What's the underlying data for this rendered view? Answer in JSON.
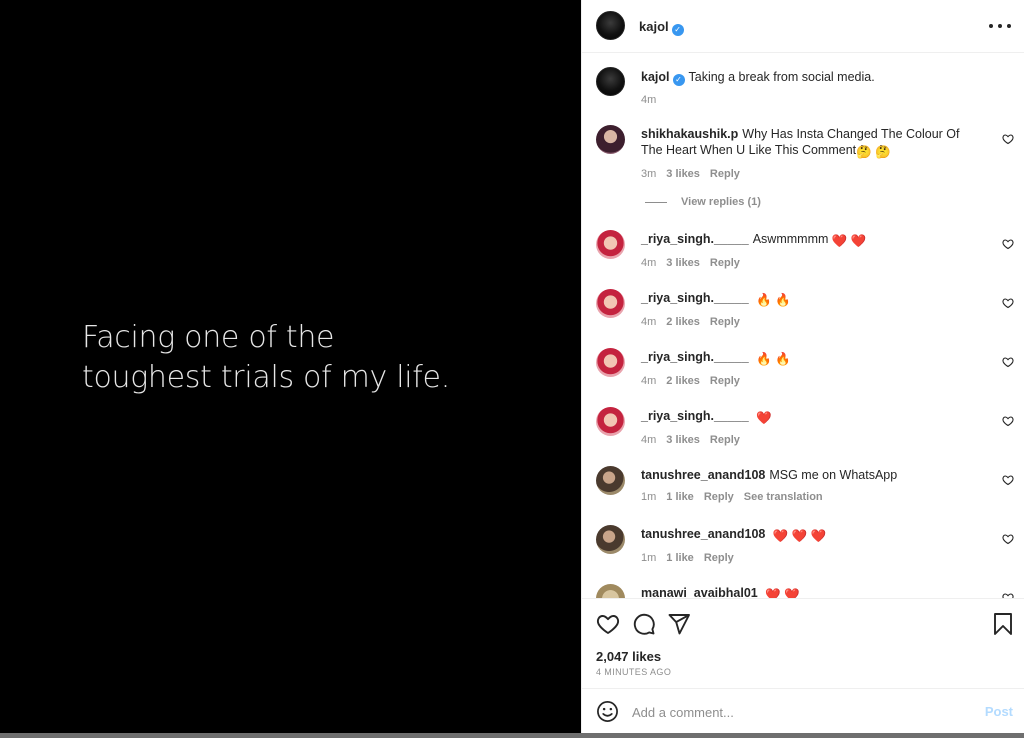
{
  "media": {
    "line1": "Facing one of the",
    "line2": "toughest trials of my life."
  },
  "header": {
    "username": "kajol",
    "verified_glyph": "✓",
    "more_icon": "more-dots-icon"
  },
  "caption": {
    "username": "kajol",
    "text": "Taking a break from social media.",
    "time": "4m"
  },
  "comments": [
    {
      "username": "shikhakaushik.p",
      "text": "Why Has Insta Changed The Colour Of The Heart When U Like This Comment",
      "emoji": "🤔 🤔",
      "time": "3m",
      "likes": "3 likes",
      "reply": "Reply",
      "view_replies": "View replies (1)"
    },
    {
      "username": "_riya_singh._____",
      "text": "Aswmmmmm",
      "emoji": "❤️ ❤️",
      "time": "4m",
      "likes": "3 likes",
      "reply": "Reply"
    },
    {
      "username": "_riya_singh._____",
      "text": "",
      "emoji": "🔥 🔥",
      "time": "4m",
      "likes": "2 likes",
      "reply": "Reply"
    },
    {
      "username": "_riya_singh._____",
      "text": "",
      "emoji": "🔥 🔥",
      "time": "4m",
      "likes": "2 likes",
      "reply": "Reply"
    },
    {
      "username": "_riya_singh._____",
      "text": "",
      "emoji": "❤️",
      "time": "4m",
      "likes": "3 likes",
      "reply": "Reply"
    },
    {
      "username": "tanushree_anand108",
      "text": "MSG me on WhatsApp",
      "emoji": "",
      "time": "1m",
      "likes": "1 like",
      "reply": "Reply",
      "translation": "See translation"
    },
    {
      "username": "tanushree_anand108",
      "text": "",
      "emoji": "❤️ ❤️ ❤️",
      "time": "1m",
      "likes": "1 like",
      "reply": "Reply"
    },
    {
      "username": "manawi_avaibhal01",
      "text": "",
      "emoji": "❤️ ❤️"
    }
  ],
  "actions": {
    "likes": "2,047 likes",
    "time_ago": "4 MINUTES AGO"
  },
  "comment_box": {
    "placeholder": "Add a comment...",
    "post_label": "Post"
  },
  "colors": {
    "accent": "#3897f0",
    "post_disabled": "#b3dbff",
    "muted": "#8e8e8e"
  }
}
